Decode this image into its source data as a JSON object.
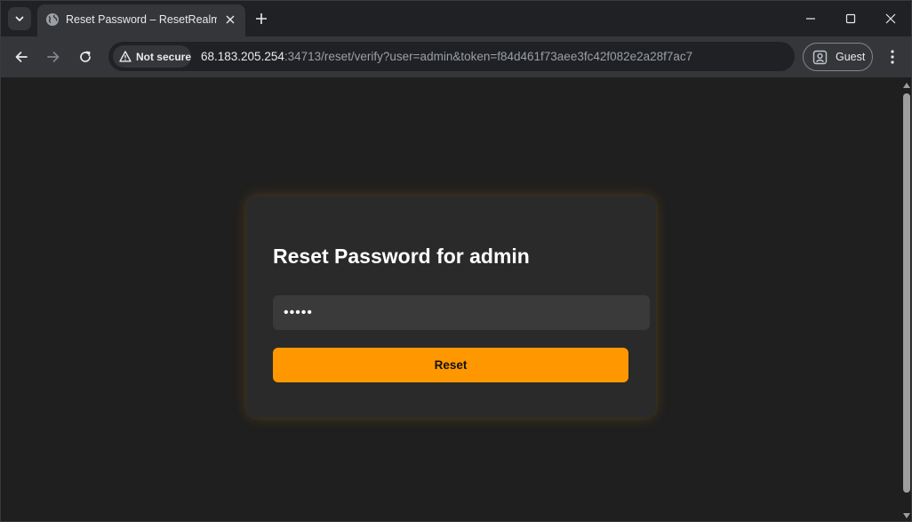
{
  "browser": {
    "tab": {
      "title": "Reset Password – ResetRealm"
    },
    "address_bar": {
      "security_label": "Not secure",
      "url_host": "68.183.205.254",
      "url_rest": ":34713/reset/verify?user=admin&token=f84d461f73aee3fc42f082e2a28f7ac7"
    },
    "profile": {
      "label": "Guest"
    }
  },
  "page": {
    "title": "Reset Password for admin",
    "password_field": {
      "value": "•••••"
    },
    "reset_button": {
      "label": "Reset"
    }
  },
  "colors": {
    "accent": "#ff9800",
    "card_background": "#2a2a2a",
    "page_background": "#1f1f1f"
  }
}
